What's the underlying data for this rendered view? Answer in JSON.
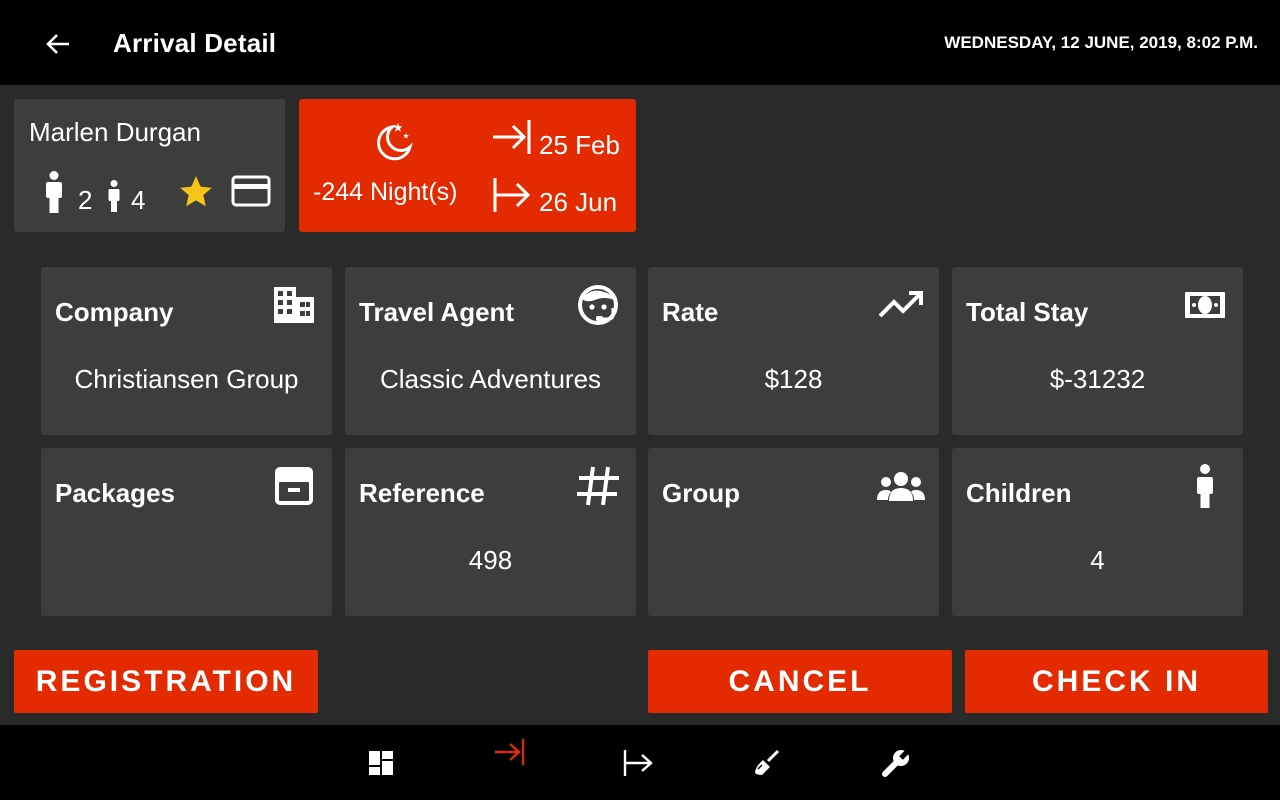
{
  "header": {
    "title": "Arrival Detail",
    "datetime": "WEDNESDAY, 12 JUNE, 2019, 8:02 P.M.",
    "back_icon": "arrow-left-icon"
  },
  "guest": {
    "name": "Marlen Durgan",
    "adults": "2",
    "children": "4",
    "vip_color": "#f5c518"
  },
  "stay": {
    "nights": "-244 Night(s)",
    "arrival_date": "25 Feb",
    "departure_date": "26 Jun",
    "accent": "#e32a00"
  },
  "tiles": [
    {
      "label": "Company",
      "value": "Christiansen Group",
      "icon": "building-icon"
    },
    {
      "label": "Travel Agent",
      "value": "Classic Adventures",
      "icon": "agent-face-icon"
    },
    {
      "label": "Rate",
      "value": "$128",
      "icon": "trending-up-icon"
    },
    {
      "label": "Total Stay",
      "value": "$-31232",
      "icon": "money-icon"
    },
    {
      "label": "Packages",
      "value": "",
      "icon": "package-icon"
    },
    {
      "label": "Reference",
      "value": "498",
      "icon": "hash-icon"
    },
    {
      "label": "Group",
      "value": "",
      "icon": "group-icon"
    },
    {
      "label": "Children",
      "value": "4",
      "icon": "child-icon"
    }
  ],
  "actions": {
    "registration": "REGISTRATION",
    "cancel": "CANCEL",
    "check_in": "CHECK IN"
  },
  "bottom_nav": [
    {
      "icon": "dashboard-icon",
      "active": false
    },
    {
      "icon": "arrivals-icon",
      "active": true
    },
    {
      "icon": "departures-icon",
      "active": false
    },
    {
      "icon": "housekeeping-icon",
      "active": false
    },
    {
      "icon": "maintenance-icon",
      "active": false
    }
  ]
}
